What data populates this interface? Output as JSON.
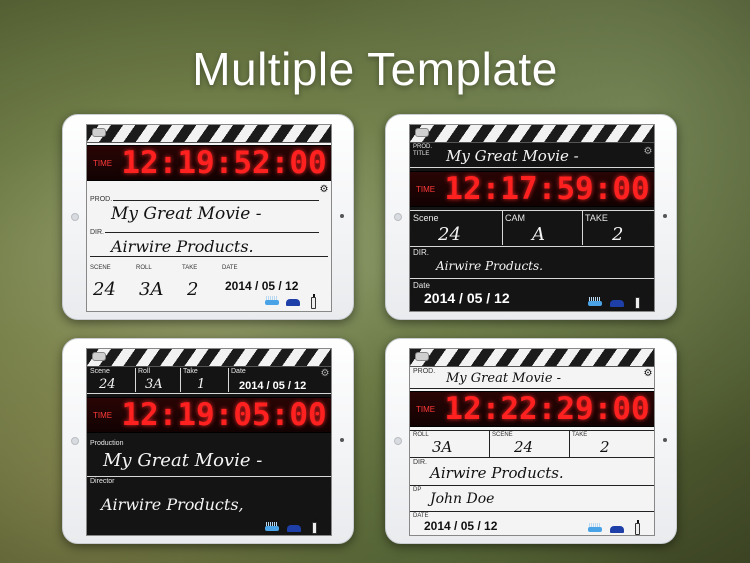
{
  "headline": "Multiple Template",
  "icons": {
    "settings": "gear-icon",
    "brush": "brush-icon",
    "car": "car-icon",
    "bottle": "bottle-icon"
  },
  "colors": {
    "timecode": "#ff2020",
    "tool_blue": "#1e3fa8"
  },
  "slate1": {
    "time_label": "TIME",
    "timecode": "12:19:52:00",
    "prod_label": "PROD.",
    "prod_value": "My Great Movie -",
    "dir_label": "DIR.",
    "dir_value": "Airwire Products.",
    "scene_label": "SCENE",
    "roll_label": "ROLL",
    "take_label": "TAKE",
    "date_label": "DATE",
    "scene_value": "24",
    "roll_value": "3A",
    "take_value": "2",
    "date_value": "2014 / 05 / 12"
  },
  "slate2": {
    "prod_label": "PROD.",
    "title_label": "TITLE",
    "title_value": "My Great Movie -",
    "time_label": "TIME",
    "timecode": "12:17:59:00",
    "scene_label": "Scene",
    "cam_label": "CAM",
    "take_label": "TAKE",
    "scene_value": "24",
    "cam_value": "A",
    "take_value": "2",
    "dir_label": "DIR.",
    "dir_value": "Airwire Products.",
    "date_label": "Date",
    "date_value": "2014 / 05 / 12"
  },
  "slate3": {
    "scene_label": "Scene",
    "roll_label": "Roll",
    "take_label": "Take",
    "date_label": "Date",
    "scene_value": "24",
    "roll_value": "3A",
    "take_value": "1",
    "date_value": "2014 / 05 / 12",
    "time_label": "TIME",
    "timecode": "12:19:05:00",
    "production_label": "Production",
    "production_value": "My Great Movie -",
    "director_label": "Director",
    "director_value": "Airwire Products,"
  },
  "slate4": {
    "prod_label": "PROD.",
    "prod_value": "My Great Movie -",
    "time_label": "TIME",
    "timecode": "12:22:29:00",
    "roll_label": "ROLL",
    "scene_label": "SCENE",
    "take_label": "TAKE",
    "roll_value": "3A",
    "scene_value": "24",
    "take_value": "2",
    "dir_label": "DIR.",
    "dir_value": "Airwire Products.",
    "dp_label": "DP",
    "dp_value": "John Doe",
    "date_label": "DATE",
    "date_value": "2014 / 05 / 12"
  }
}
